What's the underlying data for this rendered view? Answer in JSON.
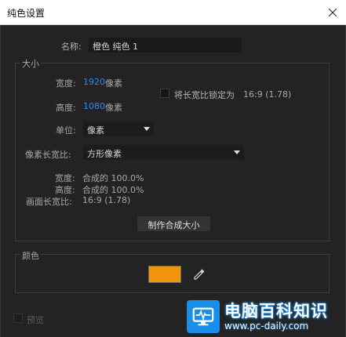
{
  "window": {
    "title": "纯色设置"
  },
  "name": {
    "label": "名称:",
    "value": "橙色 纯色 1"
  },
  "size": {
    "legend": "大小",
    "width_label": "宽度:",
    "width_value": "1920",
    "width_unit": "像素",
    "height_label": "高度:",
    "height_value": "1080",
    "height_unit": "像素",
    "lock_label": "将长宽比锁定为",
    "lock_ratio": "16:9 (1.78)",
    "lock_checked": false,
    "units_label": "单位:",
    "units_value": "像素",
    "pixel_aspect_label": "像素长宽比:",
    "pixel_aspect_value": "方形像素",
    "comp_width_label": "宽度:",
    "comp_width_value": "合成的 100.0%",
    "comp_height_label": "高度:",
    "comp_height_value": "合成的 100.0%",
    "frame_aspect_label": "画面长宽比:",
    "frame_aspect_value": "16:9 (1.78)",
    "make_comp_size_button": "制作合成大小"
  },
  "color": {
    "legend": "颜色",
    "swatch_color": "#f1960c"
  },
  "preview": {
    "label": "预览",
    "checked": false
  },
  "watermark": {
    "title": "电脑百科知识",
    "url": "www.pc-daily.com"
  },
  "colors": {
    "accent_blue": "#2d8ceb",
    "background": "#232323"
  }
}
